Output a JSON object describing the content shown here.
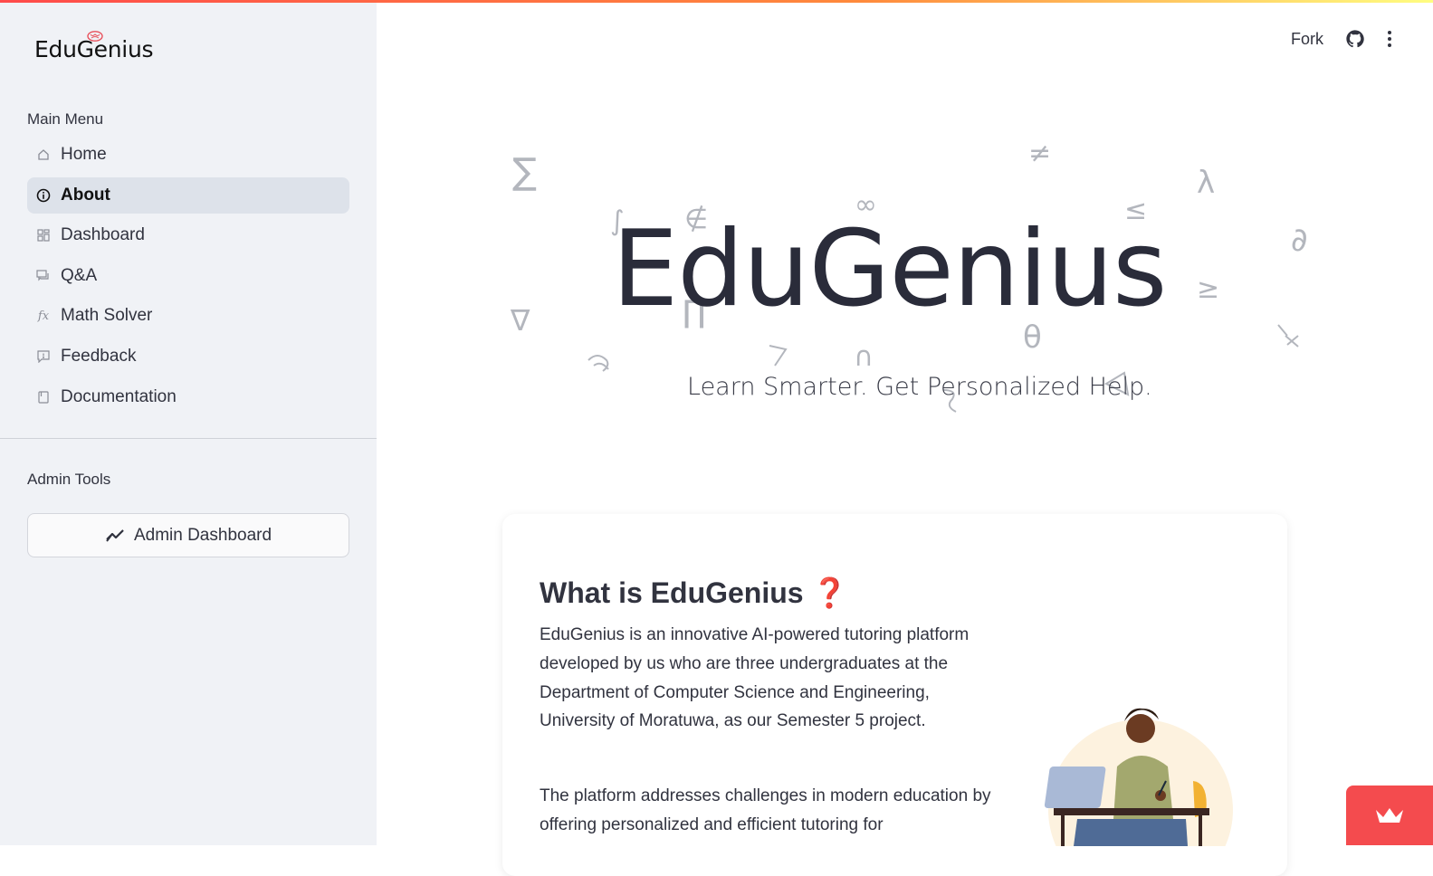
{
  "app": {
    "logo_text": "EduGenius"
  },
  "sidebar": {
    "main_menu_label": "Main Menu",
    "items": [
      {
        "label": "Home",
        "icon": "home-icon",
        "active": false
      },
      {
        "label": "About",
        "icon": "info-icon",
        "active": true
      },
      {
        "label": "Dashboard",
        "icon": "dashboard-icon",
        "active": false
      },
      {
        "label": "Q&A",
        "icon": "chat-icon",
        "active": false
      },
      {
        "label": "Math Solver",
        "icon": "function-icon",
        "active": false
      },
      {
        "label": "Feedback",
        "icon": "feedback-icon",
        "active": false
      },
      {
        "label": "Documentation",
        "icon": "book-icon",
        "active": false
      }
    ],
    "admin_label": "Admin Tools",
    "admin_button_label": "Admin Dashboard"
  },
  "header": {
    "fork_label": "Fork"
  },
  "hero": {
    "title": "EduGenius",
    "subtitle": "Learn Smarter. Get Personalized Help.",
    "symbols": [
      "∑",
      "≠",
      "λ",
      "∞",
      "∉",
      "≤",
      "∂",
      "≥",
      "∇",
      "∏",
      "θ",
      "∩",
      "∫"
    ]
  },
  "about_card": {
    "title": "What is EduGenius",
    "title_emoji": "❓",
    "paragraph1": "EduGenius is an innovative AI-powered tutoring platform developed by us who are three undergraduates at the Department of Computer Science and Engineering, University of Moratuwa, as our Semester 5 project.",
    "paragraph2": "The platform addresses challenges in modern education by offering personalized and efficient tutoring for"
  },
  "colors": {
    "accent": "#ff4b4b",
    "sidebar_bg": "#f0f2f6",
    "active_bg": "#dde2ea",
    "text": "#31333f"
  }
}
